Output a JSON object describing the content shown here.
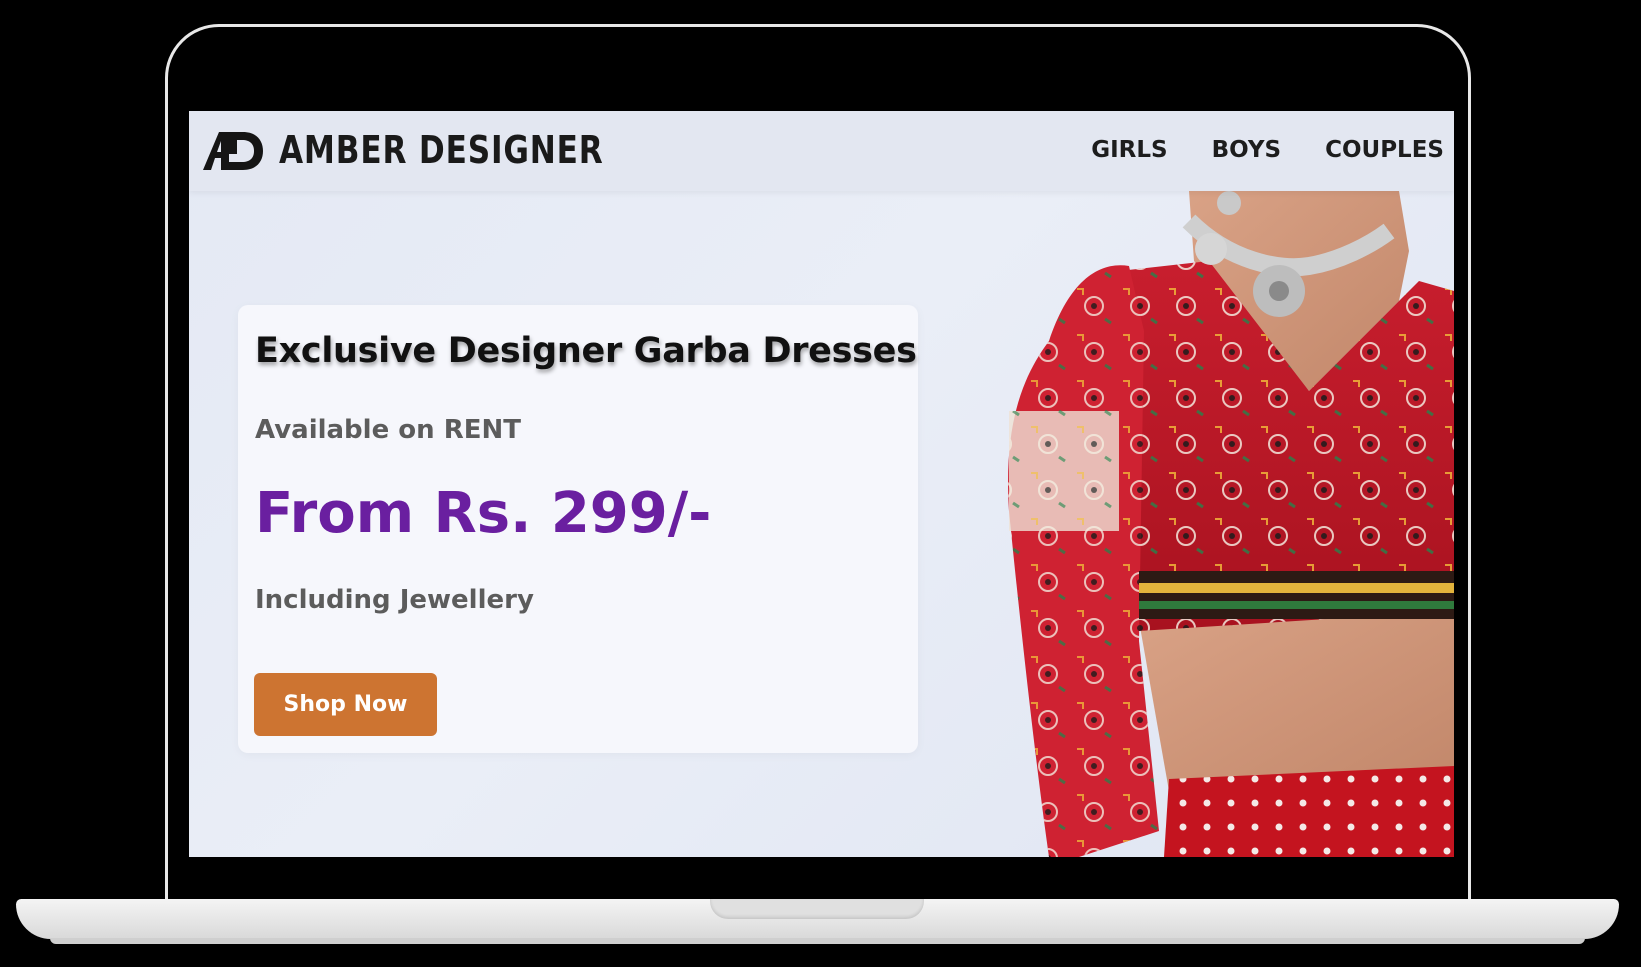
{
  "header": {
    "brand_name": "AMBER DESIGNER",
    "logo_icon": "ad-monogram-logo",
    "nav": [
      {
        "label": "GIRLS"
      },
      {
        "label": "BOYS"
      },
      {
        "label": "COUPLES"
      }
    ]
  },
  "hero": {
    "title": "Exclusive Designer Garba Dresses",
    "subtitle": "Available on RENT",
    "price": "From Rs. 299/-",
    "note": "Including Jewellery",
    "cta_label": "Shop Now"
  },
  "colors": {
    "accent_price": "#6a1fa0",
    "cta_button": "#cd7431",
    "header_bg": "#e3e7f1",
    "card_bg": "#f6f7fc"
  },
  "image": {
    "subject": "model-in-red-embroidered-chaniya-choli"
  }
}
